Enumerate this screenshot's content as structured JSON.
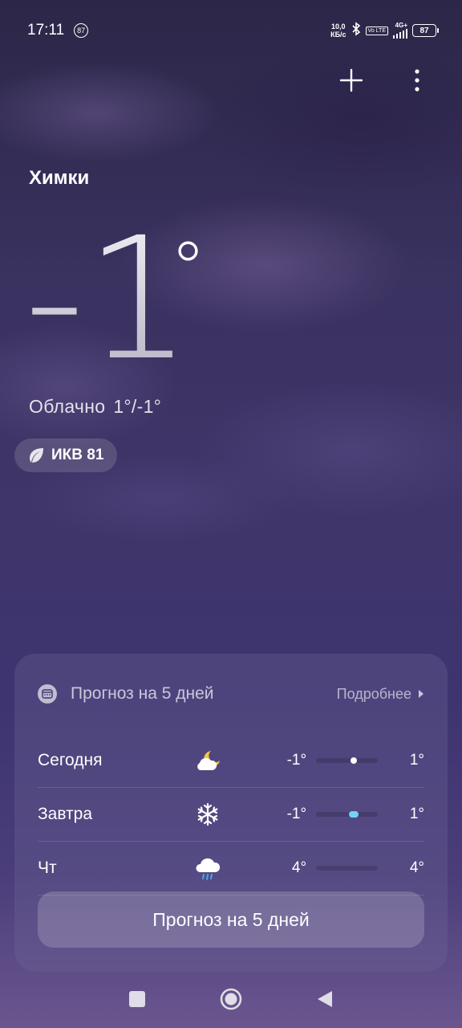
{
  "status_bar": {
    "time": "17:11",
    "notification_badge": "87",
    "net_speed_value": "10,0",
    "net_speed_unit": "КБ/с",
    "volte": "Vo LTE",
    "network": "4G+",
    "battery": "87"
  },
  "location": {
    "city": "Химки"
  },
  "current": {
    "temperature": "-1",
    "degree_symbol": "°",
    "condition": "Облачно",
    "range": "1°/-1°"
  },
  "aqi": {
    "label": "ИКВ 81"
  },
  "forecast": {
    "title": "Прогноз на 5 дней",
    "more_label": "Подробнее",
    "days": [
      {
        "name": "Сегодня",
        "icon": "cloudy-night-icon",
        "min": "-1°",
        "max": "1°",
        "bar_position": 0.6,
        "dot_color": "#ffffff"
      },
      {
        "name": "Завтра",
        "icon": "snowflake-icon",
        "min": "-1°",
        "max": "1°",
        "bar_position": 0.6,
        "dot_color": "#6fd4f5"
      },
      {
        "name": "Чт",
        "icon": "rain-cloud-icon",
        "min": "4°",
        "max": "4°",
        "bar_position": null,
        "dot_color": null
      }
    ],
    "button_label": "Прогноз на 5 дней"
  },
  "colors": {
    "accent_cold": "#6fd4f5",
    "moon": "#f5c542"
  }
}
